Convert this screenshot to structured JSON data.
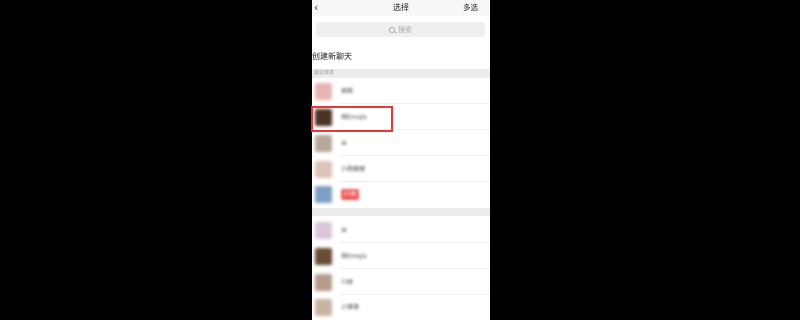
{
  "header": {
    "title": "选择",
    "multi_select": "多选",
    "back_icon": "chevron-left-icon"
  },
  "search": {
    "placeholder": "搜索",
    "icon": "search-icon"
  },
  "new_chat": "创建新聊天",
  "sections": {
    "recent": "最近转发",
    "all": ""
  },
  "highlight_color": "#e53935",
  "recent": [
    {
      "name": "胡雨",
      "avatar_color": "#e8b4b4"
    },
    {
      "name": "胡Emojis",
      "avatar_color": "#4a3325"
    },
    {
      "name": "朵",
      "avatar_color": "#b8a89a"
    },
    {
      "name": "小杨跟随",
      "avatar_color": "#dec3b8"
    },
    {
      "name": "ZY群",
      "avatar_color": "#7d9fc4"
    }
  ],
  "all": [
    {
      "name": "朵",
      "avatar_color": "#d9c7d8"
    },
    {
      "name": "胡Emojis",
      "avatar_color": "#6a4b36"
    },
    {
      "name": "川妹",
      "avatar_color": "#b79b8d"
    },
    {
      "name": "小锋锋",
      "avatar_color": "#c9b3a3"
    }
  ]
}
